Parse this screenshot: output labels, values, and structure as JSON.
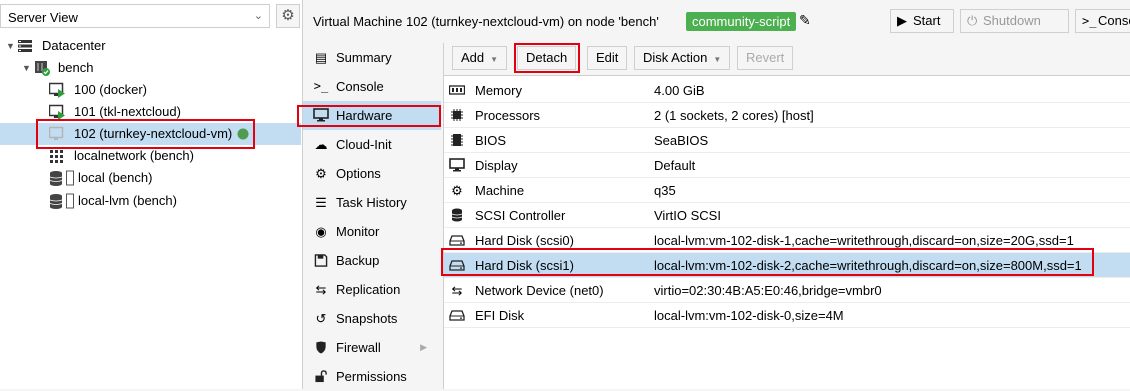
{
  "tree": {
    "view_select": "Server View",
    "nodes": [
      {
        "label": "Datacenter",
        "icon": "server-icon"
      },
      {
        "label": "bench",
        "icon": "node-online-icon"
      },
      {
        "label": "100 (docker)",
        "icon": "vm-running-icon"
      },
      {
        "label": "101 (tkl-nextcloud)",
        "icon": "vm-running-icon"
      },
      {
        "label": "102 (turnkey-nextcloud-vm)",
        "icon": "vm-stopped-icon"
      },
      {
        "label": "localnetwork (bench)",
        "icon": "network-icon"
      },
      {
        "label": "local (bench)",
        "icon": "storage-icon"
      },
      {
        "label": "local-lvm (bench)",
        "icon": "storage-icon"
      }
    ]
  },
  "header": {
    "title": "Virtual Machine 102 (turnkey-nextcloud-vm) on node 'bench'",
    "tag": "community-script",
    "buttons": {
      "start": "Start",
      "shutdown": "Shutdown",
      "console": "Console"
    }
  },
  "nav": {
    "items": [
      {
        "label": "Summary",
        "icon": "summary-icon"
      },
      {
        "label": "Console",
        "icon": "console-icon"
      },
      {
        "label": "Hardware",
        "icon": "monitor-icon"
      },
      {
        "label": "Cloud-Init",
        "icon": "cloud-icon"
      },
      {
        "label": "Options",
        "icon": "gear-icon"
      },
      {
        "label": "Task History",
        "icon": "list-icon"
      },
      {
        "label": "Monitor",
        "icon": "eye-icon"
      },
      {
        "label": "Backup",
        "icon": "floppy-icon"
      },
      {
        "label": "Replication",
        "icon": "retweet-icon"
      },
      {
        "label": "Snapshots",
        "icon": "history-icon"
      },
      {
        "label": "Firewall",
        "icon": "shield-icon"
      },
      {
        "label": "Permissions",
        "icon": "unlock-icon"
      }
    ]
  },
  "toolbar": {
    "add": "Add",
    "detach": "Detach",
    "edit": "Edit",
    "disk_action": "Disk Action",
    "revert": "Revert"
  },
  "hardware": {
    "rows": [
      {
        "name": "Memory",
        "value": "4.00 GiB",
        "icon": "memory-icon"
      },
      {
        "name": "Processors",
        "value": "2 (1 sockets, 2 cores) [host]",
        "icon": "cpu-icon"
      },
      {
        "name": "BIOS",
        "value": "SeaBIOS",
        "icon": "chip-icon"
      },
      {
        "name": "Display",
        "value": "Default",
        "icon": "display-icon"
      },
      {
        "name": "Machine",
        "value": "q35",
        "icon": "cogs-icon"
      },
      {
        "name": "SCSI Controller",
        "value": "VirtIO SCSI",
        "icon": "database-icon"
      },
      {
        "name": "Hard Disk (scsi0)",
        "value": "local-lvm:vm-102-disk-1,cache=writethrough,discard=on,size=20G,ssd=1",
        "icon": "hdd-icon"
      },
      {
        "name": "Hard Disk (scsi1)",
        "value": "local-lvm:vm-102-disk-2,cache=writethrough,discard=on,size=800M,ssd=1",
        "icon": "hdd-icon"
      },
      {
        "name": "Network Device (net0)",
        "value": "virtio=02:30:4B:A5:E0:46,bridge=vmbr0",
        "icon": "exchange-icon"
      },
      {
        "name": "EFI Disk",
        "value": "local-lvm:vm-102-disk-0,size=4M",
        "icon": "hdd-icon"
      }
    ]
  },
  "colors": {
    "selection": "#c2ddf2",
    "highlight": "#e3000f",
    "tag": "#4caf50",
    "running": "#2e9e3a"
  }
}
